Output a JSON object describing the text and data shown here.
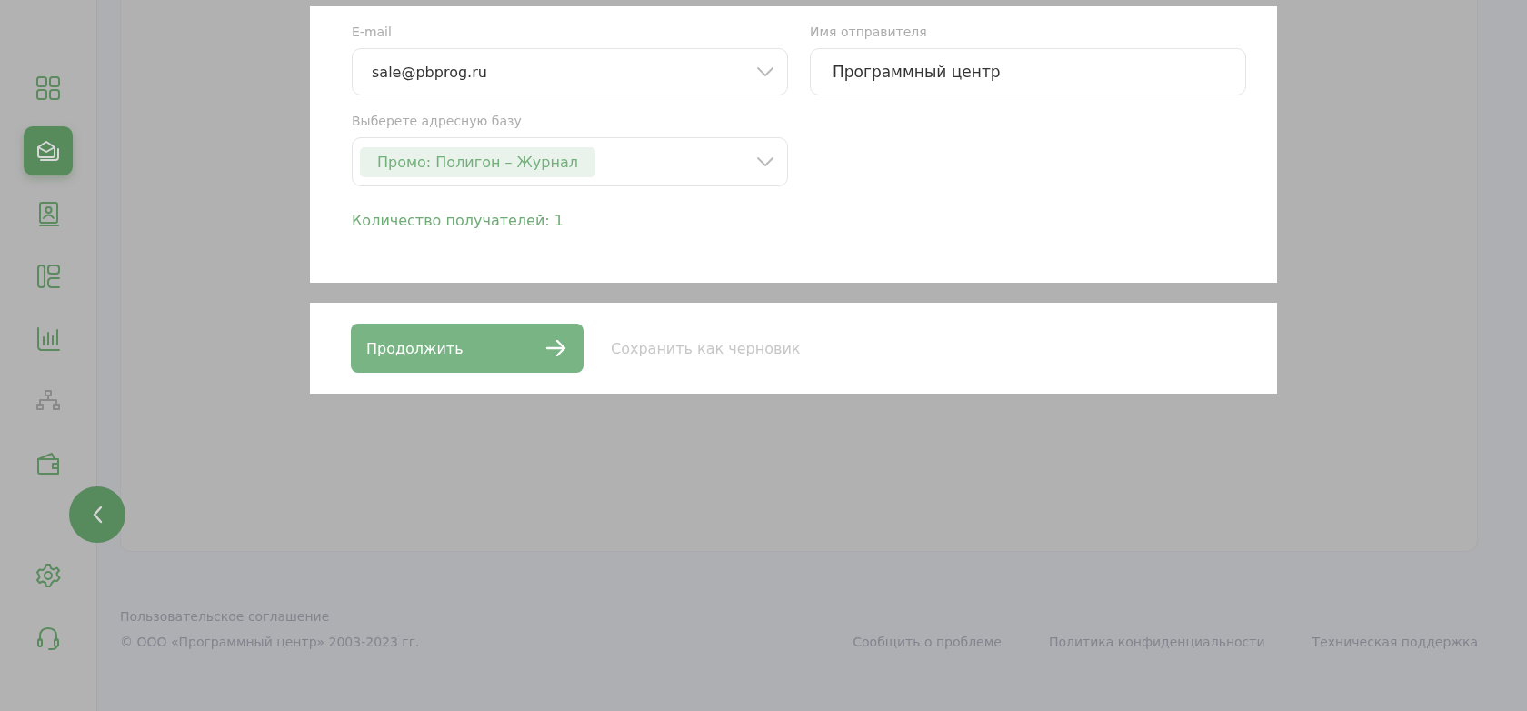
{
  "sidebar": {
    "items": [
      {
        "selected": false
      },
      {
        "selected": true
      },
      {
        "selected": false
      },
      {
        "selected": false
      },
      {
        "selected": false
      },
      {
        "selected": false
      },
      {
        "selected": false
      }
    ],
    "bottom_items": [
      {
        "selected": false
      },
      {
        "selected": false
      }
    ]
  },
  "form": {
    "fields": [
      {
        "kind": "select",
        "label": "E-mail",
        "value": "sale@pbprog.ru"
      },
      {
        "kind": "text",
        "label": "Имя отправителя",
        "value": "Программный центр"
      },
      {
        "kind": "tags",
        "label": "Выберете адресную базу",
        "tags": [
          "Промо: Полигон – Журнал"
        ]
      }
    ],
    "recipients": "Количество получателей: 1"
  },
  "actions": {
    "primary": "Продолжить",
    "secondary": "Сохранить как черновик"
  },
  "footer": {
    "agreement": "Пользовательское соглашение",
    "copyright": "© ООО «Программный центр» 2003-2023 гг.",
    "links": [
      "Сообщить о проблеме",
      "Политика конфиденциальности",
      "Техническая поддержка"
    ]
  }
}
